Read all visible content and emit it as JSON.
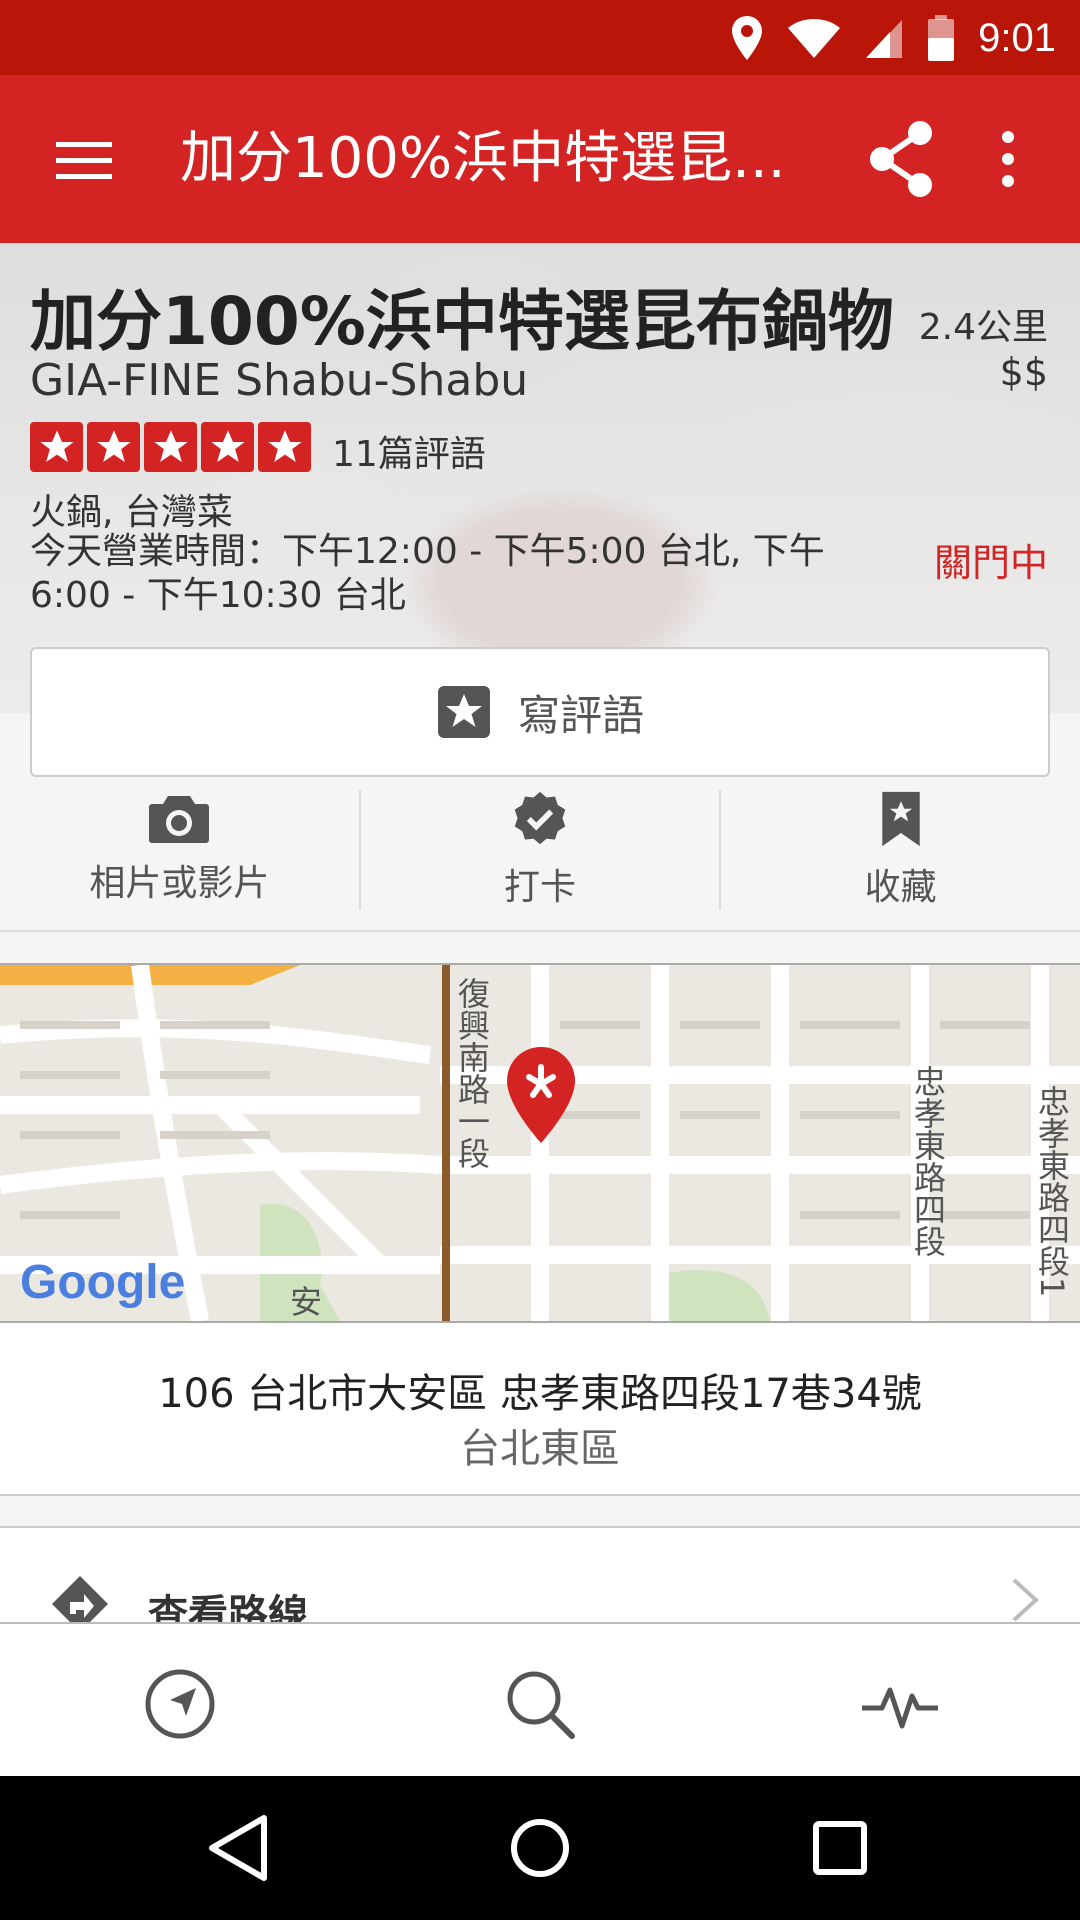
{
  "status_bar": {
    "time": "9:01"
  },
  "app_bar": {
    "title": "加分100%浜中特選昆..."
  },
  "business": {
    "name": "加分100%浜中特選昆布鍋物",
    "name_en": "GIA-FINE Shabu-Shabu",
    "distance": "2.4公里",
    "price": "$$",
    "rating": 5,
    "review_count": "11篇評語",
    "category": "火鍋, 台灣菜",
    "hours": "今天營業時間：下午12:00 - 下午5:00 台北, 下午6:00 - 下午10:30 台北",
    "open_status": "關門中"
  },
  "write_review": {
    "label": "寫評語"
  },
  "actions": [
    {
      "label": "相片或影片",
      "icon": "camera-icon"
    },
    {
      "label": "打卡",
      "icon": "check-in-badge-icon"
    },
    {
      "label": "收藏",
      "icon": "bookmark-icon"
    }
  ],
  "map": {
    "street_labels": [
      "復興南路一段",
      "忠孝東路四段",
      "忠孝東路四段1",
      "安"
    ],
    "attribution": "Google",
    "colors": {
      "accent": "#d32323",
      "map_bg": "#ebe7e1",
      "road": "#ffffff",
      "park": "#cfe3bf"
    }
  },
  "address": {
    "line": "106 台北市大安區 忠孝東路四段17巷34號",
    "neighborhood": "台北東區"
  },
  "directions": {
    "label": "查看路線"
  },
  "bottom_nav": [
    "nearby-icon",
    "search-icon",
    "activity-icon"
  ],
  "colors": {
    "brand_red": "#d32323",
    "status_red": "#b91508"
  }
}
